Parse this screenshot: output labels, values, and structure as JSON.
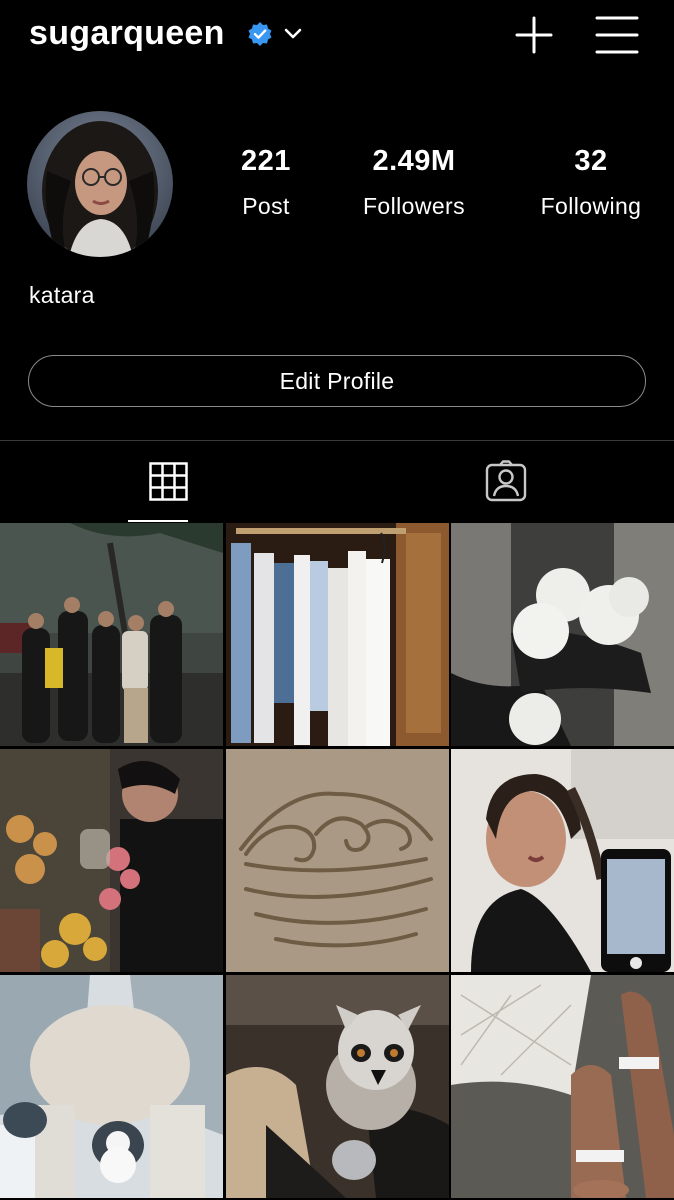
{
  "header": {
    "username": "sugarqueen",
    "icons": {
      "verified": "verified-badge-icon",
      "chevron": "chevron-down-icon",
      "create": "plus-icon",
      "menu": "hamburger-menu-icon"
    },
    "verified_color": "#3897f0"
  },
  "profile": {
    "display_name": "katara",
    "stats": [
      {
        "value": "221",
        "label": "Post"
      },
      {
        "value": "2.49M",
        "label": "Followers"
      },
      {
        "value": "32",
        "label": "Following"
      }
    ],
    "edit_button_label": "Edit Profile"
  },
  "tabs": [
    {
      "icon": "grid-icon",
      "active": true
    },
    {
      "icon": "tagged-person-icon",
      "active": false
    }
  ],
  "posts": [
    {
      "subject": "group of friends at night"
    },
    {
      "subject": "clothes on hangers in closet"
    },
    {
      "subject": "hands holding snowballs"
    },
    {
      "subject": "person smelling dried flowers"
    },
    {
      "subject": "water tribe symbol drawn in sand"
    },
    {
      "subject": "woman with braids holding phone"
    },
    {
      "subject": "snowman held in mittens"
    },
    {
      "subject": "ring-tailed lemur on lap"
    },
    {
      "subject": "ankle bracelets on feet"
    }
  ]
}
